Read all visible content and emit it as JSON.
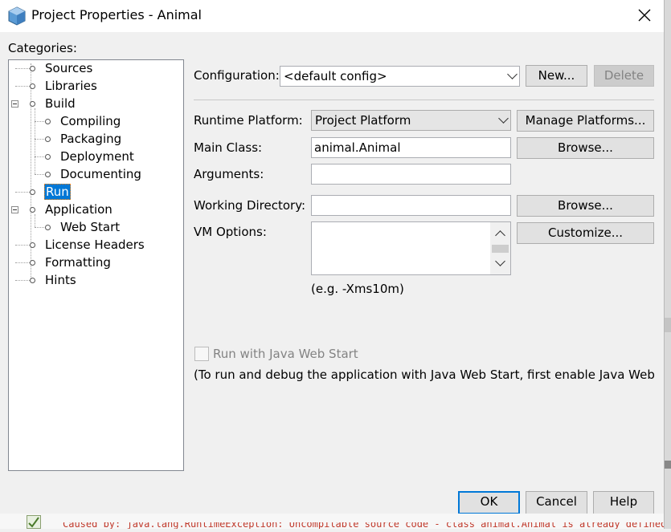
{
  "window": {
    "title": "Project Properties - Animal"
  },
  "categories": {
    "label": "Categories:",
    "items": [
      {
        "label": "Sources"
      },
      {
        "label": "Libraries"
      },
      {
        "label": "Build"
      },
      {
        "label": "Compiling"
      },
      {
        "label": "Packaging"
      },
      {
        "label": "Deployment"
      },
      {
        "label": "Documenting"
      },
      {
        "label": "Run"
      },
      {
        "label": "Application"
      },
      {
        "label": "Web Start"
      },
      {
        "label": "License Headers"
      },
      {
        "label": "Formatting"
      },
      {
        "label": "Hints"
      }
    ],
    "selected": "Run"
  },
  "config": {
    "label": "Configuration:",
    "value": "<default config>",
    "new_label": "New...",
    "delete_label": "Delete"
  },
  "run": {
    "runtime_label": "Runtime Platform:",
    "runtime_value": "Project Platform",
    "manage_platforms_label": "Manage Platforms...",
    "main_class_label": "Main Class:",
    "main_class_value": "animal.Animal",
    "browse_label": "Browse...",
    "arguments_label": "Arguments:",
    "arguments_value": "",
    "working_dir_label": "Working Directory:",
    "working_dir_value": "",
    "vm_options_label": "VM Options:",
    "vm_options_value": "",
    "customize_label": "Customize...",
    "vm_hint": "(e.g. -Xms10m)",
    "web_start_checkbox_label": "Run with Java Web Start",
    "web_start_note": "(To run and debug the application with Java Web Start, first enable Java Web St.."
  },
  "footer": {
    "ok_label": "OK",
    "cancel_label": "Cancel",
    "help_label": "Help"
  },
  "background": {
    "error_text": "Caused by: java.lang.RuntimeException: Uncompilable source code - class animal.Animal is already defined in"
  },
  "colors": {
    "selection": "#0078d7",
    "default_button_border": "#0078d7",
    "error_text": "#c0392b"
  }
}
